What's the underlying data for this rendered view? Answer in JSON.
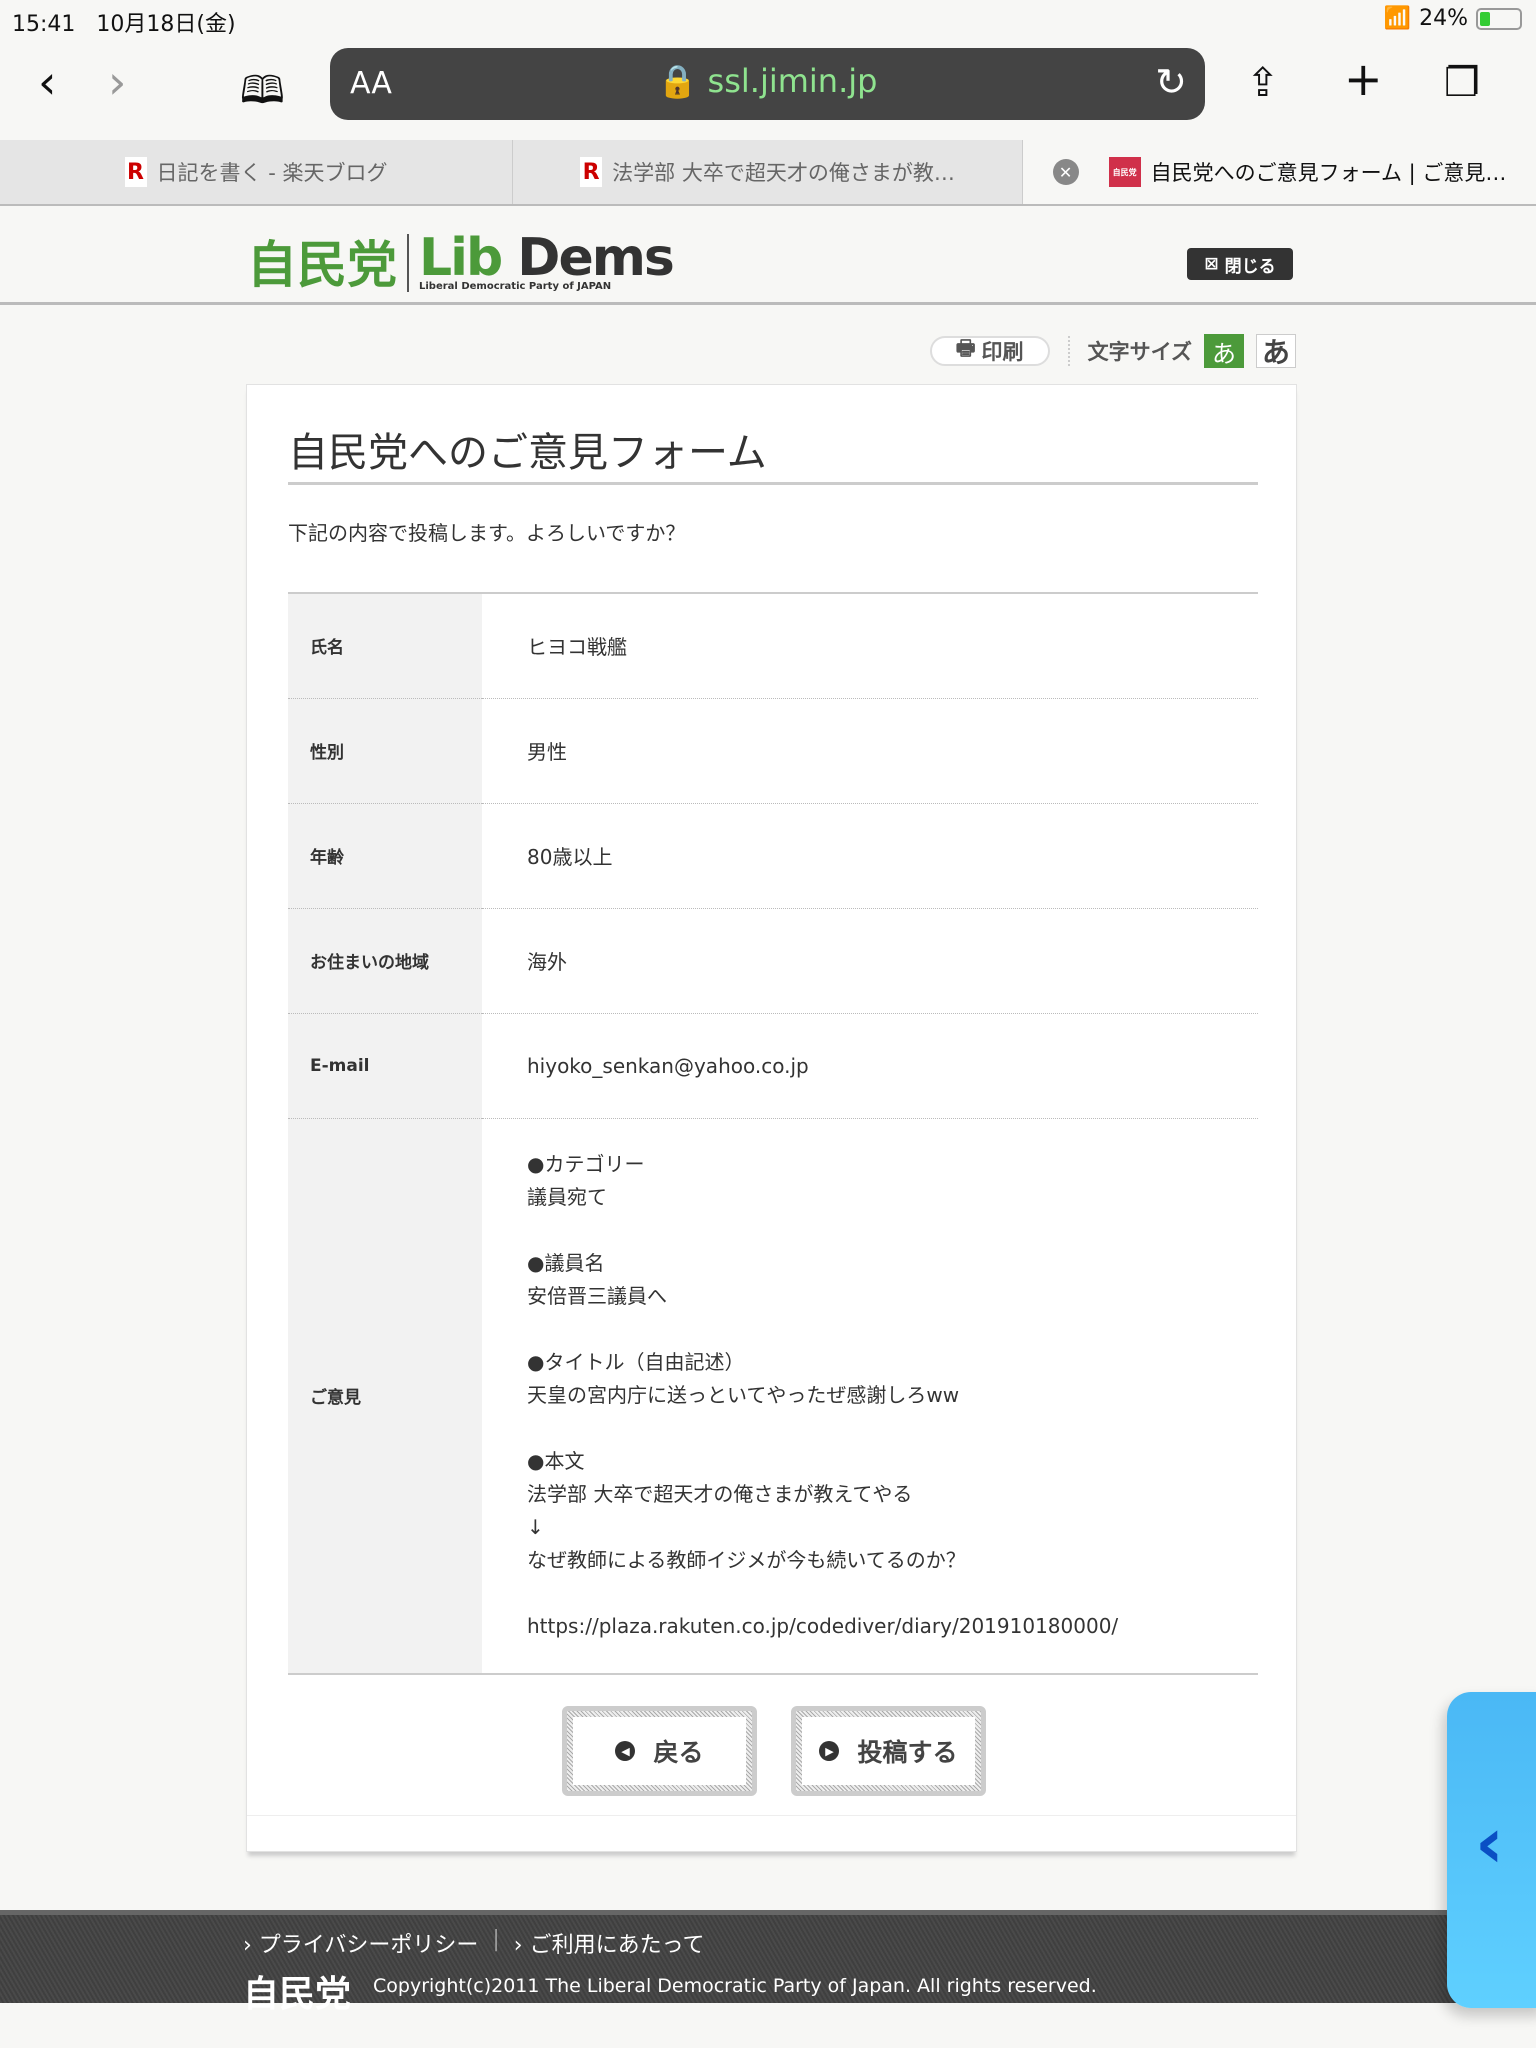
{
  "status": {
    "time": "15:41",
    "date": "10月18日(金)",
    "battery": "24%"
  },
  "browser": {
    "aa": "AA",
    "host": "ssl.jimin.jp"
  },
  "tabs": [
    {
      "icon": "R",
      "label": "日記を書く - 楽天ブログ"
    },
    {
      "icon": "R",
      "label": "法学部 大卒で超天才の俺さまが教…"
    },
    {
      "icon": "自民党",
      "label": "自民党へのご意見フォーム | ご意見…"
    }
  ],
  "header": {
    "logo_kanji": "自民党",
    "logo_lib": "Lib",
    "logo_dems": "Dems",
    "logo_sub": "Liberal Democratic Party of JAPAN",
    "close": "閉じる"
  },
  "tools": {
    "print": "印刷",
    "font_size": "文字サイズ",
    "small": "あ",
    "large": "あ"
  },
  "form": {
    "title": "自民党へのご意見フォーム",
    "lead": "下記の内容で投稿します。よろしいですか？",
    "rows": [
      {
        "label": "氏名",
        "value": "ヒヨコ戦艦"
      },
      {
        "label": "性別",
        "value": "男性"
      },
      {
        "label": "年齢",
        "value": "80歳以上"
      },
      {
        "label": "お住まいの地域",
        "value": "海外"
      },
      {
        "label": "E-mail",
        "value": "hiyoko_senkan@yahoo.co.jp"
      }
    ],
    "opinion_label": "ご意見",
    "opinion_lines": [
      "●カテゴリー",
      "議員宛て",
      "",
      "●議員名",
      "安倍晋三議員へ",
      "",
      "●タイトル（自由記述）",
      "天皇の宮内庁に送っといてやったぜ感謝しろww",
      "",
      "●本文",
      "法学部 大卒で超天才の俺さまが教えてやる",
      "↓",
      "なぜ教師による教師イジメが今も続いてるのか？",
      "",
      "https://plaza.rakuten.co.jp/codediver/diary/201910180000/"
    ],
    "back": "戻る",
    "submit": "投稿する"
  },
  "footer": {
    "privacy": "プライバシーポリシー",
    "terms": "ご利用にあたって",
    "logo": "自民党",
    "copyright": "Copyright(c)2011 The Liberal Democratic Party of Japan. All rights reserved."
  }
}
